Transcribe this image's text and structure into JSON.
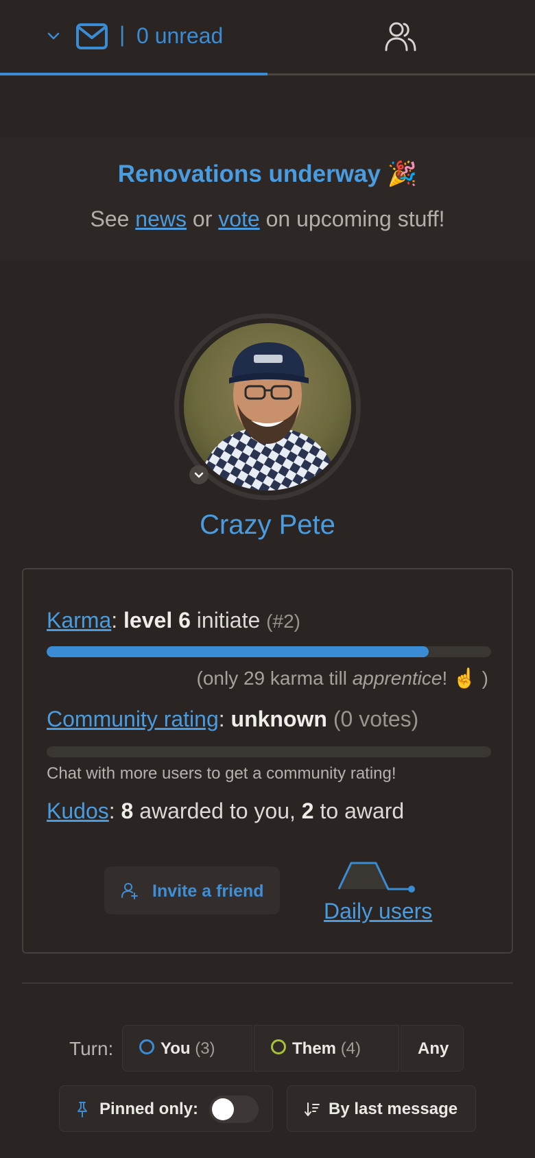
{
  "tabs": {
    "messages": {
      "separator": "|",
      "unread_label": "0 unread",
      "icon": "mail-icon"
    },
    "users": {
      "icon": "users-icon"
    }
  },
  "banner": {
    "title": "Renovations underway 🎉",
    "sub_prefix": "See ",
    "news_link": "news",
    "sub_mid": " or ",
    "vote_link": "vote",
    "sub_suffix": " on upcoming stuff!"
  },
  "profile": {
    "name": "Crazy Pete"
  },
  "stats": {
    "karma_link": "Karma",
    "karma_colon": ": ",
    "karma_level": "level 6",
    "karma_rank_word": " initiate ",
    "karma_rank": "(#2)",
    "karma_progress_percent": 86,
    "karma_note_prefix": "(only 29 karma till ",
    "karma_note_em": "apprentice",
    "karma_note_suffix": "! ☝️ )",
    "community_link": "Community rating",
    "community_colon": ": ",
    "community_value": "unknown",
    "community_votes": " (0 votes)",
    "community_progress_percent": 0,
    "community_note": "Chat with more users to get a community rating!",
    "kudos_link": "Kudos",
    "kudos_colon": ": ",
    "kudos_awarded": "8",
    "kudos_awarded_text": " awarded to you, ",
    "kudos_to_award": "2",
    "kudos_to_award_text": " to award"
  },
  "actions": {
    "invite_label": "Invite a friend",
    "daily_users_label": "Daily users"
  },
  "filters": {
    "turn_label": "Turn:",
    "you_label": "You",
    "you_count": "(3)",
    "them_label": "Them",
    "them_count": "(4)",
    "any_label": "Any",
    "pinned_label": "Pinned only:",
    "pinned_enabled": false,
    "sort_label": "By last message"
  },
  "colors": {
    "accent": "#3a8cd4",
    "you_dot": "#3a8cd4",
    "them_dot": "#a7c236",
    "background": "#2a2523"
  }
}
